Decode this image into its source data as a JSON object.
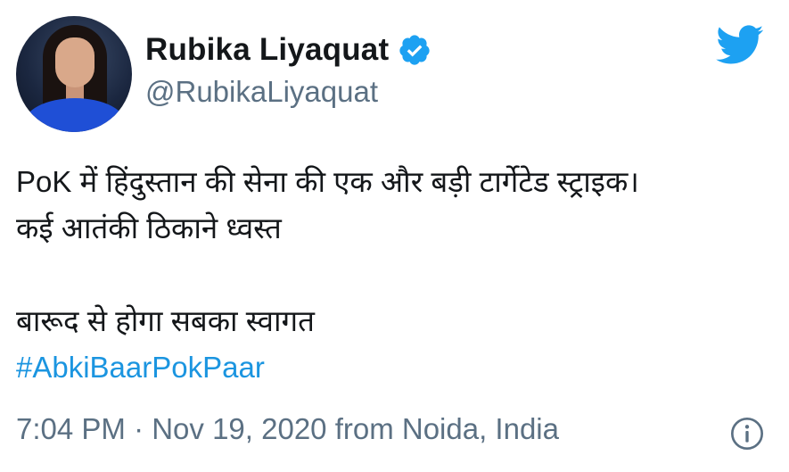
{
  "user": {
    "display_name": "Rubika Liyaquat",
    "handle": "@RubikaLiyaquat",
    "verified": true
  },
  "tweet": {
    "lines": [
      "PoK में हिंदुस्तान की सेना की एक और बड़ी टार्गेटेड स्ट्राइक।",
      "कई आतंकी ठिकाने ध्वस्त",
      "बारूद से होगा सबका स्वागत"
    ],
    "hashtag": "#AbkiBaarPokPaar",
    "meta": "7:04 PM · Nov 19, 2020 from Noida, India"
  },
  "icons": {
    "brand": "twitter-bird-icon",
    "verified": "verified-badge-icon",
    "info": "info-icon"
  },
  "colors": {
    "brand": "#1da1f2",
    "link": "#1b95e0",
    "secondary_text": "#5b7083",
    "primary_text": "#14171a"
  }
}
